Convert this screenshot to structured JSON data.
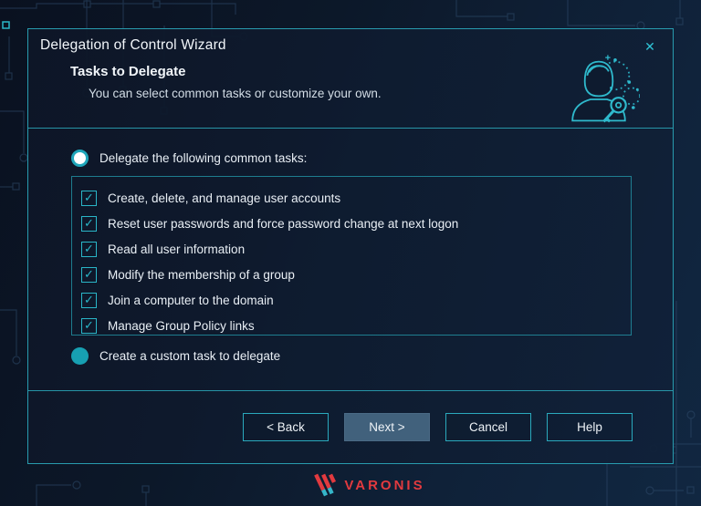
{
  "colors": {
    "accent_teal": "#2ab6c8",
    "brand_red": "#e23a3f",
    "primary_button_fill": "#41617c",
    "background_navy": "#0c1728"
  },
  "icons": {
    "close": "✕",
    "check": "✓",
    "header_illustration": "user-with-key",
    "brand_mark": "varonis-triple-slash"
  },
  "dialog": {
    "title": "Delegation of Control Wizard",
    "heading": "Tasks to Delegate",
    "subheading": "You can select common tasks or customize your own.",
    "options": {
      "common": {
        "label": "Delegate the following common tasks:",
        "selected": true
      },
      "custom": {
        "label": "Create a custom task to delegate",
        "selected": false
      }
    },
    "tasks": [
      {
        "label": "Create, delete, and manage user accounts",
        "checked": true
      },
      {
        "label": "Reset user passwords and force password change at next logon",
        "checked": true
      },
      {
        "label": "Read all user information",
        "checked": true
      },
      {
        "label": "Modify the membership of a group",
        "checked": true
      },
      {
        "label": "Join a computer to the domain",
        "checked": true
      },
      {
        "label": "Manage Group Policy links",
        "checked": true
      }
    ],
    "buttons": {
      "back": "< Back",
      "next": "Next >",
      "cancel": "Cancel",
      "help": "Help"
    }
  },
  "footer": {
    "brand": "VARONIS"
  }
}
